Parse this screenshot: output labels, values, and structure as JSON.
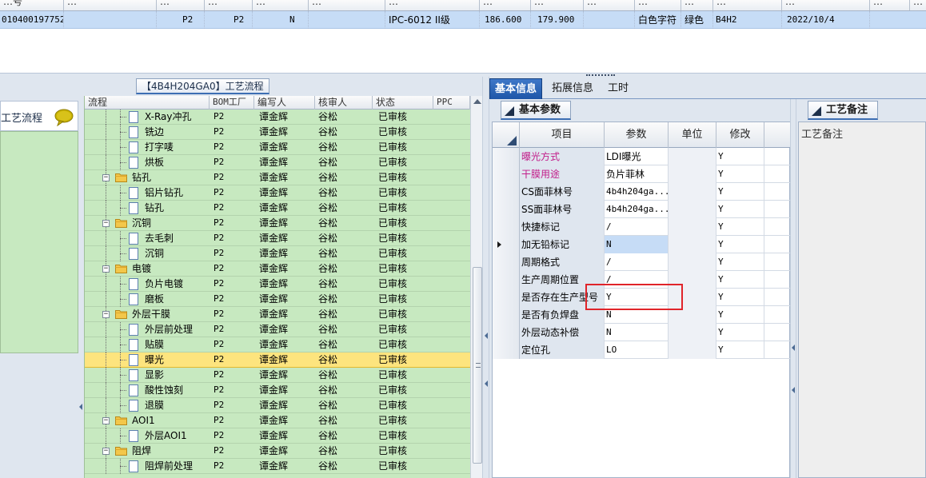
{
  "top_grid": {
    "headers": [
      "…号",
      "…",
      "…",
      "…",
      "…",
      "…",
      "…",
      "…",
      "…",
      "…",
      "…",
      "…",
      "…",
      "…",
      "…",
      "…",
      "…",
      "…"
    ],
    "row": {
      "code": "010400197752",
      "c1": "P2",
      "c2": "P2",
      "c3": "N",
      "spec": "IPC-6012 II级",
      "w": "186.600",
      "h": "179.900",
      "char_color": "白色字符",
      "mask_color": "绿色",
      "code2": "B4H2",
      "date": "2022/10/4"
    }
  },
  "left": {
    "panel_title": "【4B4H204GA0】工艺流程",
    "sidebar_label": "工艺流程",
    "sidebar_icon": "speech-bubble-icon",
    "tree_columns": [
      "流程",
      "BOM工厂",
      "编写人",
      "核审人",
      "状态",
      "PPC"
    ],
    "tree_rows": [
      {
        "level": 2,
        "type": "item",
        "name": "X-Ray冲孔",
        "factory": "P2",
        "writer": "谭金辉",
        "reviewer": "谷松",
        "status": "已审核",
        "selected": false
      },
      {
        "level": 2,
        "type": "item",
        "name": "铣边",
        "factory": "P2",
        "writer": "谭金辉",
        "reviewer": "谷松",
        "status": "已审核",
        "selected": false
      },
      {
        "level": 2,
        "type": "item",
        "name": "打字唛",
        "factory": "P2",
        "writer": "谭金辉",
        "reviewer": "谷松",
        "status": "已审核",
        "selected": false
      },
      {
        "level": 2,
        "type": "item",
        "name": "烘板",
        "factory": "P2",
        "writer": "谭金辉",
        "reviewer": "谷松",
        "status": "已审核",
        "selected": false
      },
      {
        "level": 1,
        "type": "folder",
        "name": "钻孔",
        "factory": "P2",
        "writer": "谭金辉",
        "reviewer": "谷松",
        "status": "已审核",
        "selected": false
      },
      {
        "level": 2,
        "type": "item",
        "name": "铝片钻孔",
        "factory": "P2",
        "writer": "谭金辉",
        "reviewer": "谷松",
        "status": "已审核",
        "selected": false
      },
      {
        "level": 2,
        "type": "item",
        "name": "钻孔",
        "factory": "P2",
        "writer": "谭金辉",
        "reviewer": "谷松",
        "status": "已审核",
        "selected": false
      },
      {
        "level": 1,
        "type": "folder",
        "name": "沉铜",
        "factory": "P2",
        "writer": "谭金辉",
        "reviewer": "谷松",
        "status": "已审核",
        "selected": false
      },
      {
        "level": 2,
        "type": "item",
        "name": "去毛刺",
        "factory": "P2",
        "writer": "谭金辉",
        "reviewer": "谷松",
        "status": "已审核",
        "selected": false
      },
      {
        "level": 2,
        "type": "item",
        "name": "沉铜",
        "factory": "P2",
        "writer": "谭金辉",
        "reviewer": "谷松",
        "status": "已审核",
        "selected": false
      },
      {
        "level": 1,
        "type": "folder",
        "name": "电镀",
        "factory": "P2",
        "writer": "谭金辉",
        "reviewer": "谷松",
        "status": "已审核",
        "selected": false
      },
      {
        "level": 2,
        "type": "item",
        "name": "负片电镀",
        "factory": "P2",
        "writer": "谭金辉",
        "reviewer": "谷松",
        "status": "已审核",
        "selected": false
      },
      {
        "level": 2,
        "type": "item",
        "name": "磨板",
        "factory": "P2",
        "writer": "谭金辉",
        "reviewer": "谷松",
        "status": "已审核",
        "selected": false
      },
      {
        "level": 1,
        "type": "folder",
        "name": "外层干膜",
        "factory": "P2",
        "writer": "谭金辉",
        "reviewer": "谷松",
        "status": "已审核",
        "selected": false
      },
      {
        "level": 2,
        "type": "item",
        "name": "外层前处理",
        "factory": "P2",
        "writer": "谭金辉",
        "reviewer": "谷松",
        "status": "已审核",
        "selected": false
      },
      {
        "level": 2,
        "type": "item",
        "name": "贴膜",
        "factory": "P2",
        "writer": "谭金辉",
        "reviewer": "谷松",
        "status": "已审核",
        "selected": false
      },
      {
        "level": 2,
        "type": "item",
        "name": "曝光",
        "factory": "P2",
        "writer": "谭金辉",
        "reviewer": "谷松",
        "status": "已审核",
        "selected": true
      },
      {
        "level": 2,
        "type": "item",
        "name": "显影",
        "factory": "P2",
        "writer": "谭金辉",
        "reviewer": "谷松",
        "status": "已审核",
        "selected": false
      },
      {
        "level": 2,
        "type": "item",
        "name": "酸性蚀刻",
        "factory": "P2",
        "writer": "谭金辉",
        "reviewer": "谷松",
        "status": "已审核",
        "selected": false
      },
      {
        "level": 2,
        "type": "item",
        "name": "退膜",
        "factory": "P2",
        "writer": "谭金辉",
        "reviewer": "谷松",
        "status": "已审核",
        "selected": false
      },
      {
        "level": 1,
        "type": "folder",
        "name": "AOI1",
        "factory": "P2",
        "writer": "谭金辉",
        "reviewer": "谷松",
        "status": "已审核",
        "selected": false
      },
      {
        "level": 2,
        "type": "item",
        "name": "外层AOI1",
        "factory": "P2",
        "writer": "谭金辉",
        "reviewer": "谷松",
        "status": "已审核",
        "selected": false
      },
      {
        "level": 1,
        "type": "folder",
        "name": "阻焊",
        "factory": "P2",
        "writer": "谭金辉",
        "reviewer": "谷松",
        "status": "已审核",
        "selected": false
      },
      {
        "level": 2,
        "type": "item",
        "name": "阻焊前处理",
        "factory": "P2",
        "writer": "谭金辉",
        "reviewer": "谷松",
        "status": "已审核",
        "selected": false
      }
    ]
  },
  "right": {
    "tabs": [
      "基本信息",
      "拓展信息",
      "工时"
    ],
    "active_tab": 0,
    "basic_title": "基本参数",
    "columns": {
      "item": "项目",
      "param": "参数",
      "unit": "单位",
      "modify": "修改"
    },
    "rows": [
      {
        "item": "曝光方式",
        "param": "LDI曝光",
        "unit": "",
        "modify": "Y",
        "pink": true,
        "mono": false,
        "highlight": false,
        "pointer": false
      },
      {
        "item": "干膜用途",
        "param": "负片菲林",
        "unit": "",
        "modify": "Y",
        "pink": true,
        "mono": false,
        "highlight": false,
        "pointer": false
      },
      {
        "item": "CS面菲林号",
        "param": "4b4h204ga...",
        "unit": "",
        "modify": "Y",
        "pink": false,
        "mono": true,
        "highlight": false,
        "pointer": false
      },
      {
        "item": "SS面菲林号",
        "param": "4b4h204ga...",
        "unit": "",
        "modify": "Y",
        "pink": false,
        "mono": true,
        "highlight": false,
        "pointer": false
      },
      {
        "item": "快捷标记",
        "param": "/",
        "unit": "",
        "modify": "Y",
        "pink": false,
        "mono": true,
        "highlight": false,
        "pointer": false
      },
      {
        "item": "加无铅标记",
        "param": "N",
        "unit": "",
        "modify": "Y",
        "pink": false,
        "mono": true,
        "highlight": true,
        "pointer": true
      },
      {
        "item": "周期格式",
        "param": "/",
        "unit": "",
        "modify": "Y",
        "pink": false,
        "mono": true,
        "highlight": false,
        "pointer": false
      },
      {
        "item": "生产周期位置",
        "param": "/",
        "unit": "",
        "modify": "Y",
        "pink": false,
        "mono": true,
        "highlight": false,
        "pointer": false
      },
      {
        "item": "是否存在生产型号",
        "param": "Y",
        "unit": "",
        "modify": "Y",
        "pink": false,
        "mono": true,
        "highlight": false,
        "pointer": false
      },
      {
        "item": "是否有负焊盘",
        "param": "N",
        "unit": "",
        "modify": "Y",
        "pink": false,
        "mono": true,
        "highlight": false,
        "pointer": false
      },
      {
        "item": "外层动态补偿",
        "param": "N",
        "unit": "",
        "modify": "Y",
        "pink": false,
        "mono": true,
        "highlight": false,
        "pointer": false
      },
      {
        "item": "定位孔",
        "param": "LO",
        "unit": "",
        "modify": "Y",
        "pink": false,
        "mono": true,
        "highlight": false,
        "pointer": false
      }
    ],
    "notes_title": "工艺备注",
    "notes_label": "工艺备注"
  },
  "colors": {
    "tree_bg": "#c7e9c0",
    "selection": "#fde47e",
    "row_highlight": "#c6dcf6",
    "tab_active": "#2b62b4",
    "annotation_red": "#e0242a",
    "pink_label": "#c21d8a"
  }
}
